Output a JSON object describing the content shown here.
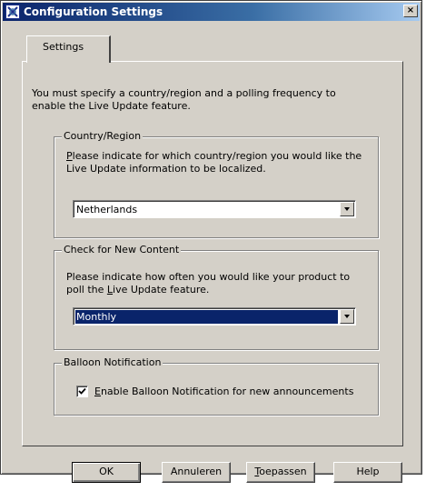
{
  "window": {
    "title": "Configuration Settings",
    "close_glyph": "×"
  },
  "tabs": [
    {
      "label": "Settings"
    }
  ],
  "intro_text": "You must specify a country/region and a polling frequency to enable the Live Update feature.",
  "country_group": {
    "title": "Country/Region",
    "description_mnemonic": "P",
    "description_rest": "lease indicate for which country/region you would like the Live Update information to be localized.",
    "selected_value": "Netherlands"
  },
  "content_group": {
    "title": "Check for New Content",
    "description_line1": "Please indicate how often you would like your product to",
    "description_pre": "poll the ",
    "description_mnemonic": "L",
    "description_post": "ive Update feature.",
    "selected_value": "Monthly"
  },
  "balloon_group": {
    "title": "Balloon Notification",
    "checkbox_mnemonic": "E",
    "checkbox_rest": "nable Balloon Notification for new announcements",
    "checked": true
  },
  "buttons": {
    "ok": "OK",
    "cancel": "Annuleren",
    "apply_mnemonic": "T",
    "apply_rest": "oepassen",
    "help": "Help"
  },
  "icons": {
    "window_icon": "app-icon",
    "dropdown": "chevron-down-icon",
    "check": "check-icon"
  },
  "colors": {
    "title_bar": "#0a246a",
    "dialog_bg": "#d4d0c8",
    "selection": "#0a246a"
  }
}
